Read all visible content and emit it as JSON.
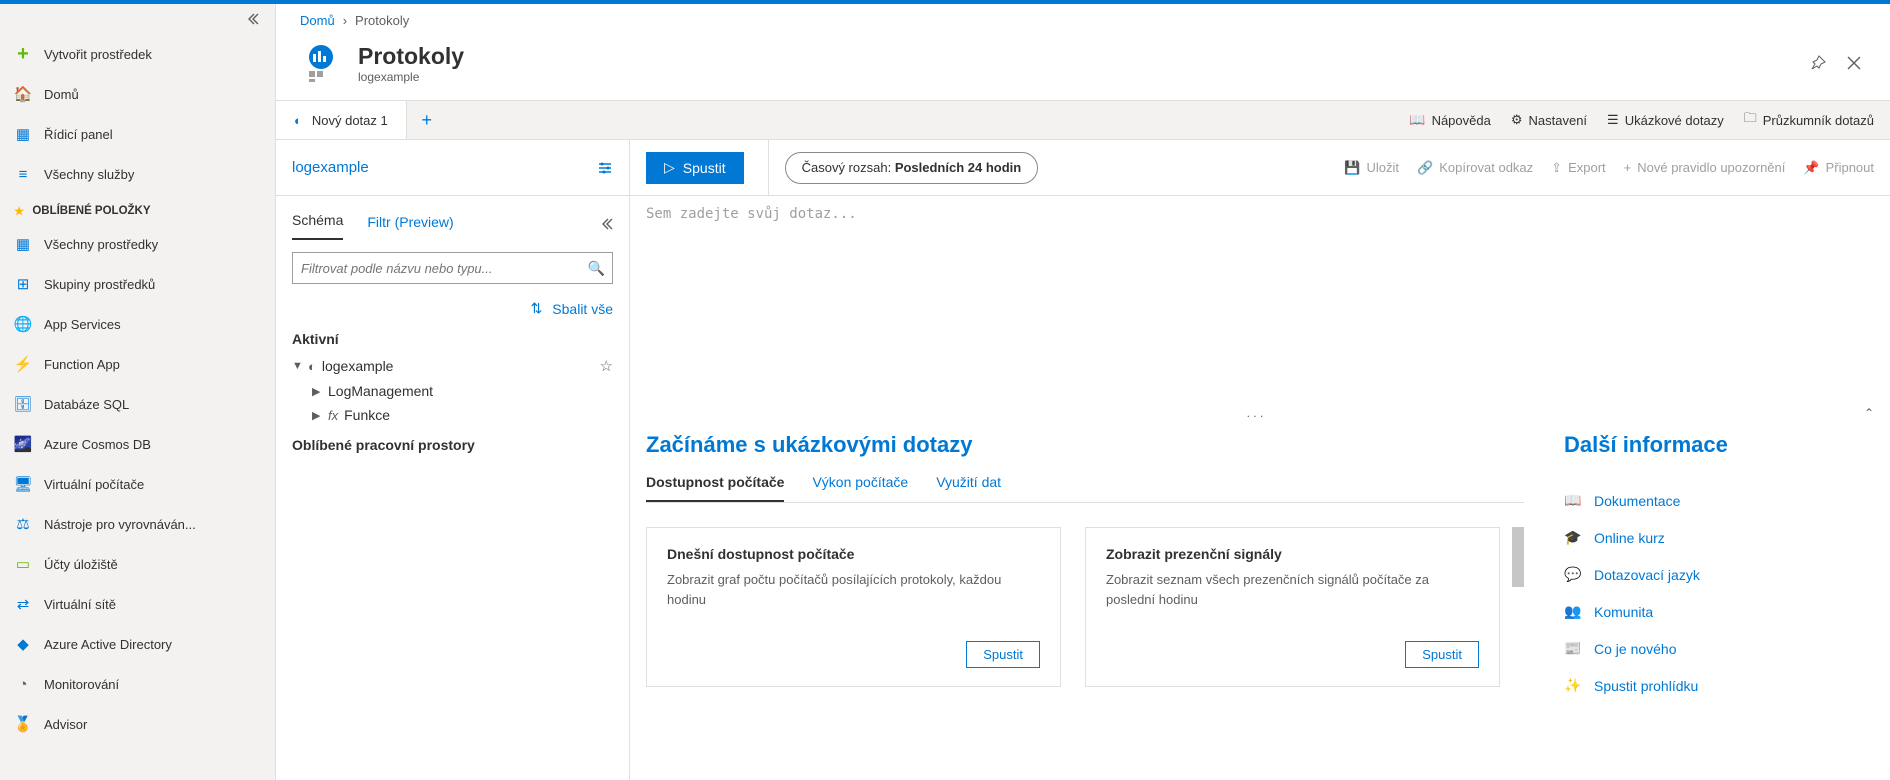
{
  "sidebar": {
    "create": "Vytvořit prostředek",
    "home": "Domů",
    "dashboard": "Řídicí panel",
    "all_services": "Všechny služby",
    "favorites_title": "Oblíbené položky",
    "items": [
      {
        "label": "Všechny prostředky"
      },
      {
        "label": "Skupiny prostředků"
      },
      {
        "label": "App Services"
      },
      {
        "label": "Function App"
      },
      {
        "label": "Databáze SQL"
      },
      {
        "label": "Azure Cosmos DB"
      },
      {
        "label": "Virtuální počítače"
      },
      {
        "label": "Nástroje pro vyrovnáván..."
      },
      {
        "label": "Účty úložiště"
      },
      {
        "label": "Virtuální sítě"
      },
      {
        "label": "Azure Active Directory"
      },
      {
        "label": "Monitorování"
      },
      {
        "label": "Advisor"
      }
    ]
  },
  "breadcrumb": {
    "home": "Domů",
    "current": "Protokoly"
  },
  "header": {
    "title": "Protokoly",
    "subtitle": "logexample"
  },
  "tabs": {
    "query_tab": "Nový dotaz 1",
    "right": {
      "help": "Nápověda",
      "settings": "Nastavení",
      "sample_queries": "Ukázkové dotazy",
      "query_explorer": "Průzkumník dotazů"
    }
  },
  "schema": {
    "workspace_link": "logexample",
    "tab_schema": "Schéma",
    "tab_filter": "Filtr (Preview)",
    "filter_placeholder": "Filtrovat podle názvu nebo typu...",
    "collapse_all": "Sbalit vše",
    "active_label": "Aktivní",
    "root": "logexample",
    "child_log_mgmt": "LogManagement",
    "child_fx_label": "Funkce",
    "child_fx_icon": "fx",
    "fav_workspaces": "Oblíbené pracovní prostory"
  },
  "query": {
    "run_label": "Spustit",
    "time_range_label": "Časový rozsah:",
    "time_range_value": "Posledních 24 hodin",
    "editor_placeholder": "Sem zadejte svůj dotaz...",
    "top_buttons": {
      "save": "Uložit",
      "copy_link": "Kopírovat odkaz",
      "export": "Export",
      "new_alert": "Nové pravidlo upozornění",
      "pin": "Připnout"
    }
  },
  "samples": {
    "title": "Začínáme s ukázkovými dotazy",
    "tabs": {
      "availability": "Dostupnost počítače",
      "perf": "Výkon počítače",
      "data_usage": "Využití dat"
    },
    "cards": [
      {
        "title": "Dnešní dostupnost počítače",
        "desc": "Zobrazit graf počtu počítačů posílajících protokoly, každou hodinu",
        "btn": "Spustit"
      },
      {
        "title": "Zobrazit prezenční signály",
        "desc": "Zobrazit seznam všech prezenčních signálů počítače za poslední hodinu",
        "btn": "Spustit"
      }
    ]
  },
  "more_info": {
    "title": "Další informace",
    "links": [
      {
        "label": "Dokumentace"
      },
      {
        "label": "Online kurz"
      },
      {
        "label": "Dotazovací jazyk"
      },
      {
        "label": "Komunita"
      },
      {
        "label": "Co je nového"
      },
      {
        "label": "Spustit prohlídku"
      }
    ]
  }
}
